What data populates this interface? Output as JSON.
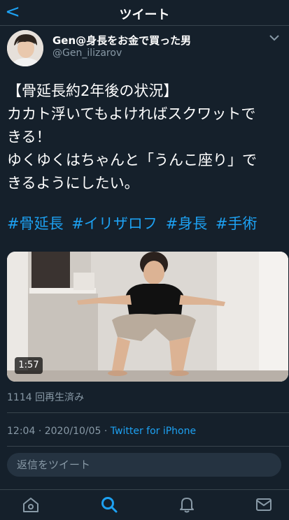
{
  "header": {
    "back_label": "<",
    "title": "ツイート"
  },
  "author": {
    "name": "Gen@身長をお金で買った男",
    "handle": "@Gen_ilizarov"
  },
  "tweet": {
    "text": "【骨延長約2年後の状況】\nカカト浮いてもよければスクワットで\nきる！\nゆくゆくはちゃんと「うんこ座り」で\nきるようにしたい。",
    "hashtags": [
      "#骨延長",
      "#イリザロフ",
      "#身長",
      "#手術"
    ]
  },
  "video": {
    "duration": "1:57",
    "views": "1114 回再生済み"
  },
  "meta": {
    "time": "12:04",
    "date": "2020/10/05",
    "client": "Twitter for iPhone"
  },
  "reply": {
    "placeholder": "返信をツイート"
  },
  "tabs": [
    {
      "icon": "home-icon"
    },
    {
      "icon": "search-icon"
    },
    {
      "icon": "notifications-icon"
    },
    {
      "icon": "messages-icon"
    }
  ],
  "colors": {
    "background": "#15202b",
    "accent": "#1da1f2",
    "muted": "#8899a6",
    "divider": "#38444d"
  }
}
